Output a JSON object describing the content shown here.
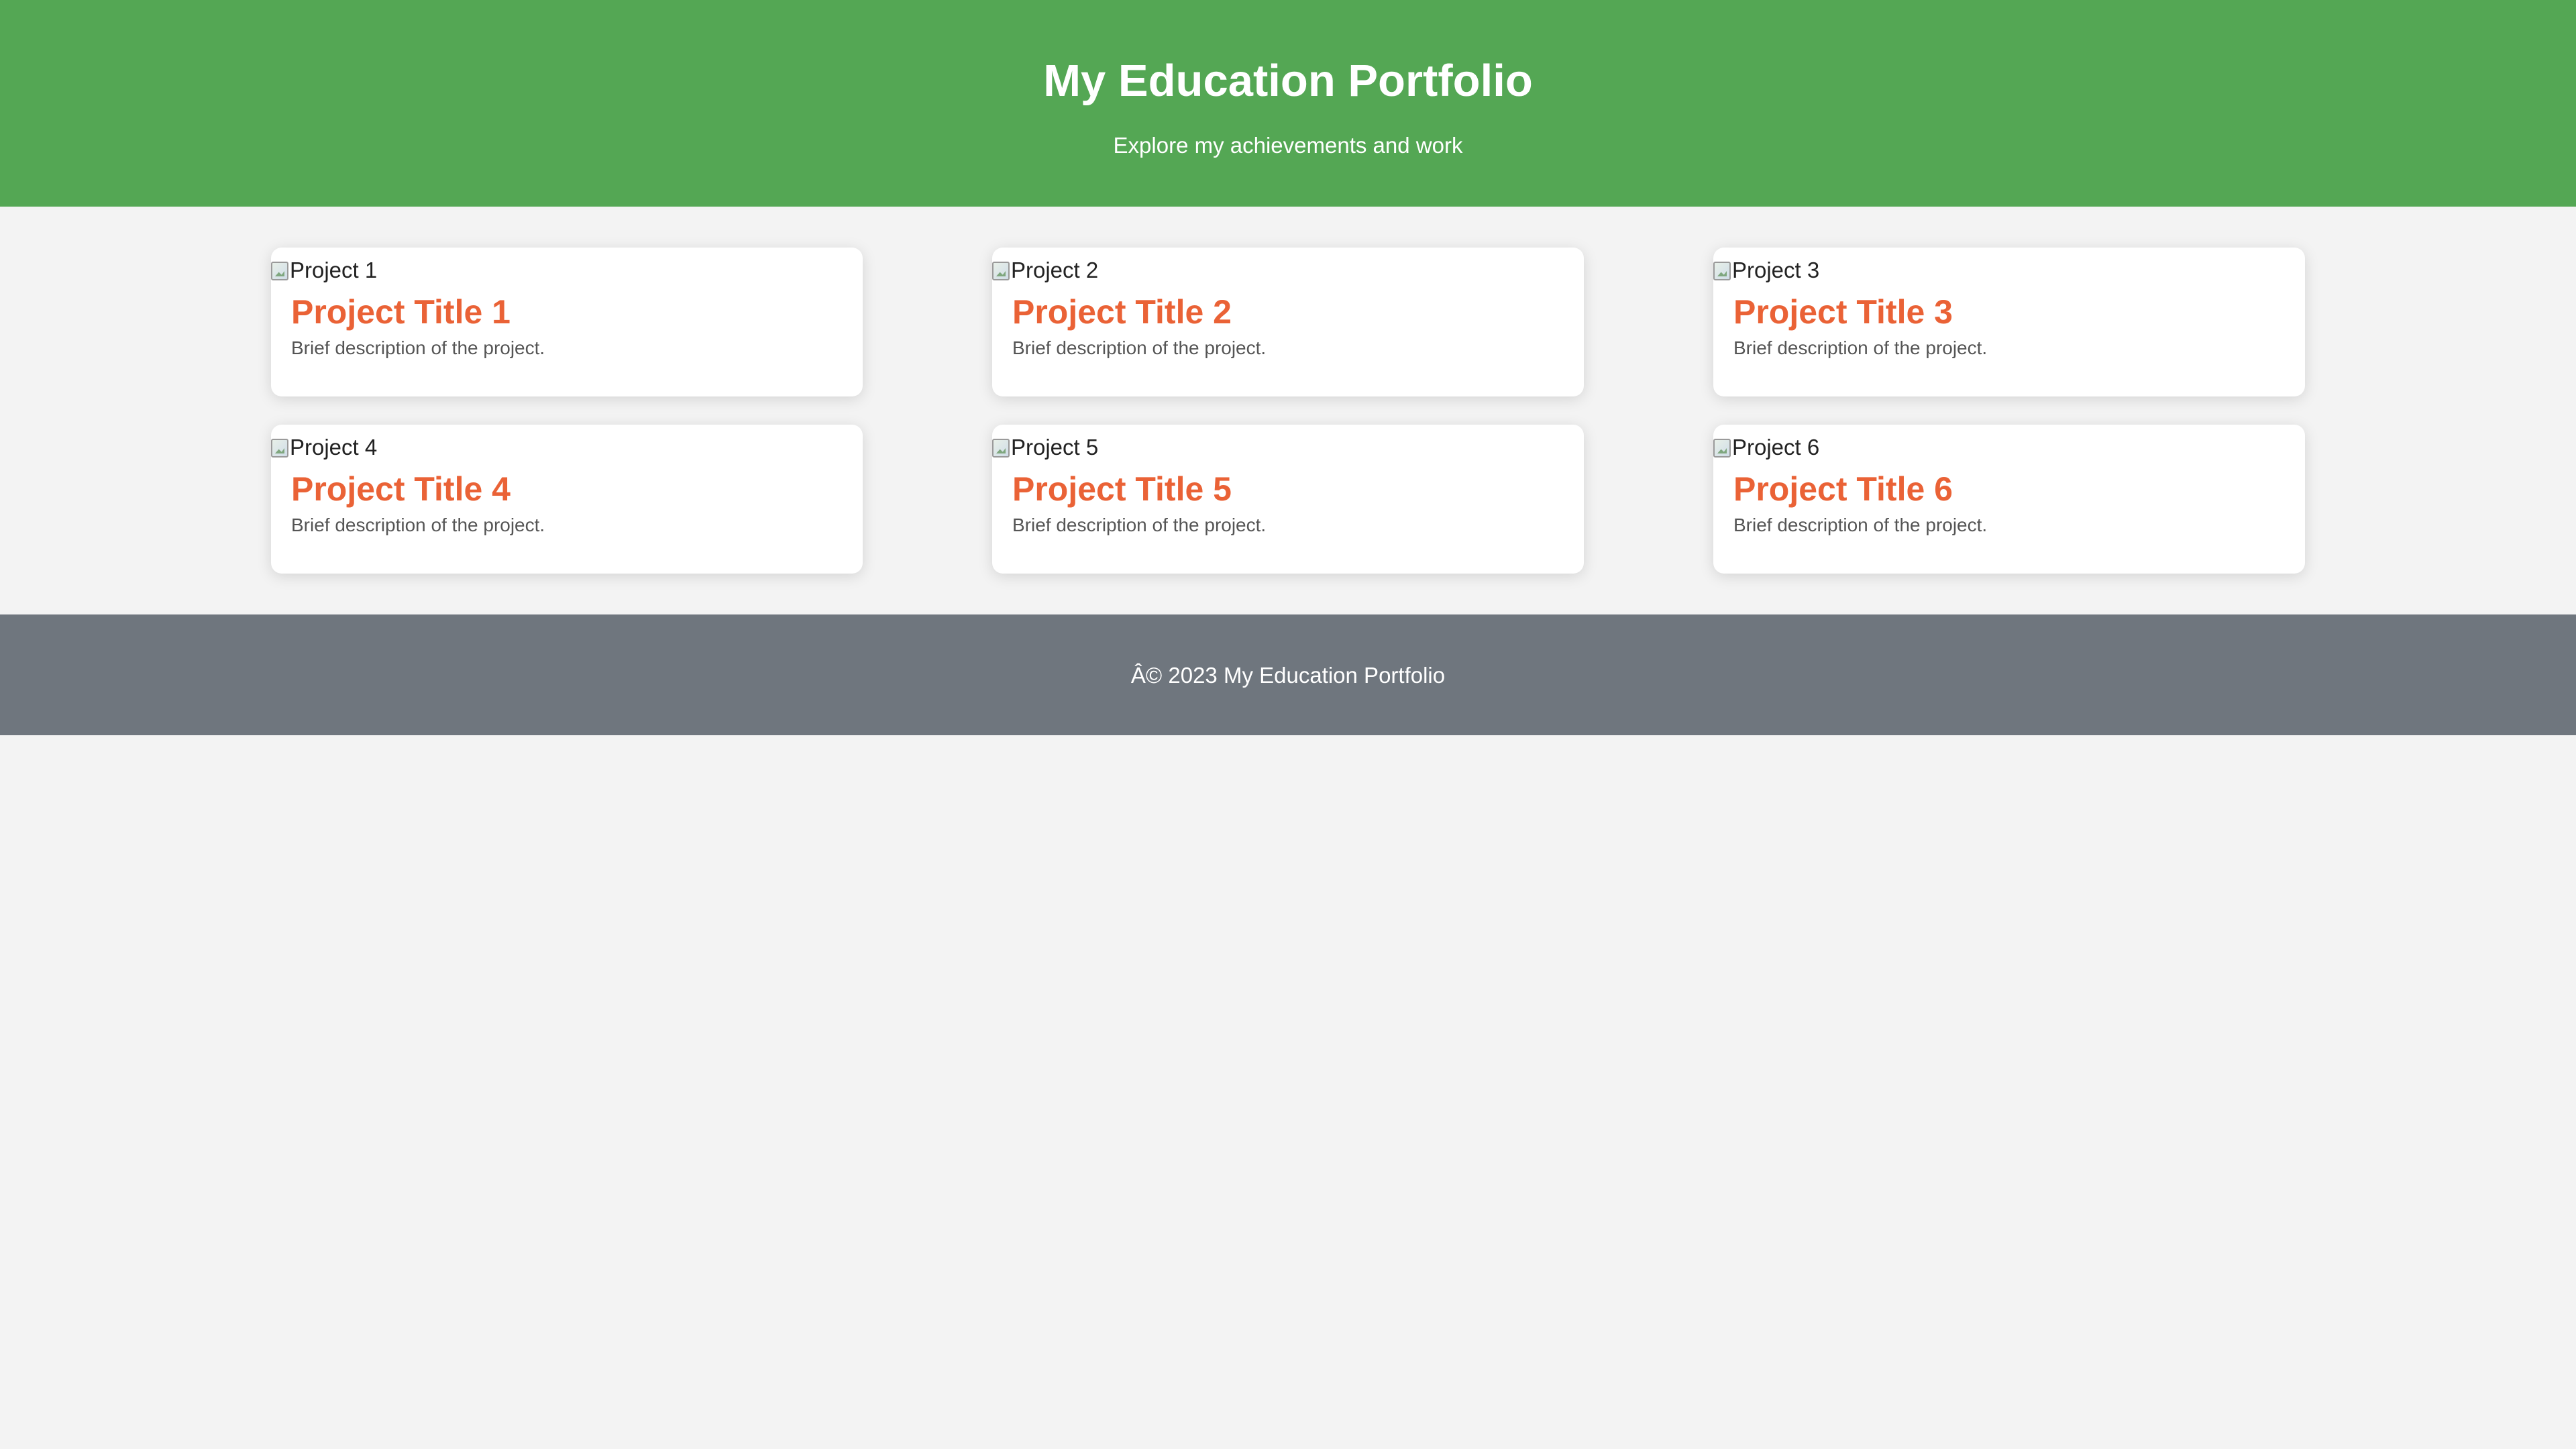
{
  "header": {
    "title": "My Education Portfolio",
    "subtitle": "Explore my achievements and work"
  },
  "projects": [
    {
      "alt": "Project 1",
      "title": "Project Title 1",
      "description": "Brief description of the project."
    },
    {
      "alt": "Project 2",
      "title": "Project Title 2",
      "description": "Brief description of the project."
    },
    {
      "alt": "Project 3",
      "title": "Project Title 3",
      "description": "Brief description of the project."
    },
    {
      "alt": "Project 4",
      "title": "Project Title 4",
      "description": "Brief description of the project."
    },
    {
      "alt": "Project 5",
      "title": "Project Title 5",
      "description": "Brief description of the project."
    },
    {
      "alt": "Project 6",
      "title": "Project Title 6",
      "description": "Brief description of the project."
    }
  ],
  "footer": {
    "text": "Â© 2023 My Education Portfolio"
  },
  "colors": {
    "header_bg": "#54a754",
    "accent_title": "#ea6236",
    "footer_bg": "#6f767e",
    "page_bg": "#f3f3f3"
  },
  "icons": {
    "image_placeholder": "broken-image-icon"
  }
}
